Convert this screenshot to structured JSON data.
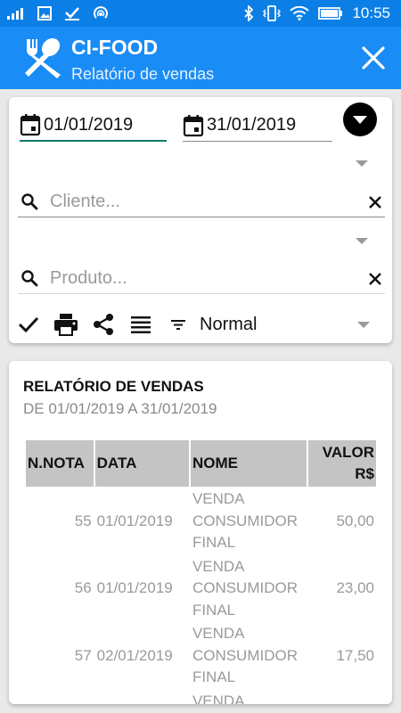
{
  "status_bar": {
    "time": "10:55",
    "left_icons": [
      "signal-icon",
      "image-icon",
      "check-icon",
      "wifi-hotspot-icon"
    ],
    "right_icons": [
      "bluetooth-icon",
      "vibrate-icon",
      "wifi-icon",
      "battery-icon"
    ]
  },
  "app_bar": {
    "title": "CI-FOOD",
    "subtitle": "Relatório de vendas",
    "logo_icon": "fork-spoon-icon",
    "close_icon": "close-icon",
    "color": "#1a8cf5"
  },
  "filters": {
    "date_start": "01/01/2019",
    "date_end": "31/01/2019",
    "cliente_placeholder": "Cliente...",
    "produto_placeholder": "Produto...",
    "mode_selected": "Normal",
    "accent_color": "#127a6a"
  },
  "toolbar_icons": [
    "check-icon",
    "print-icon",
    "share-icon",
    "list-icon",
    "filter-icon"
  ],
  "report": {
    "title": "RELATÓRIO DE VENDAS",
    "subtitle": "DE 01/01/2019 A 31/01/2019",
    "columns": [
      "N.NOTA",
      "DATA",
      "NOME",
      "VALOR R$"
    ],
    "rows": [
      {
        "nota": "55",
        "data": "01/01/2019",
        "nome": "VENDA CONSUMIDOR FINAL",
        "valor": "50,00"
      },
      {
        "nota": "56",
        "data": "01/01/2019",
        "nome": "VENDA CONSUMIDOR FINAL",
        "valor": "23,00"
      },
      {
        "nota": "57",
        "data": "02/01/2019",
        "nome": "VENDA CONSUMIDOR FINAL",
        "valor": "17,50"
      },
      {
        "nota": "",
        "data": "",
        "nome": "VENDA",
        "valor": ""
      }
    ]
  }
}
